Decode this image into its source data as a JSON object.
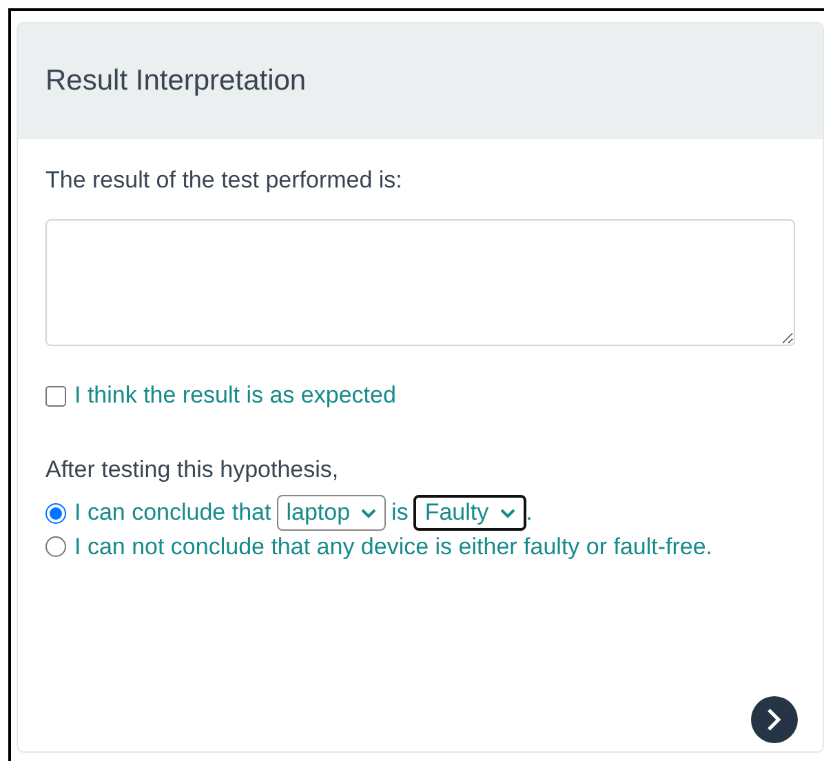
{
  "panel": {
    "title": "Result Interpretation",
    "prompt": "The result of the test performed is:",
    "expected_check": {
      "label": "I think the result is as expected",
      "checked": false
    },
    "conclusion": {
      "lead": "After testing this hypothesis,",
      "options": [
        {
          "kind": "statement",
          "selected": true,
          "text_before": "I can conclude that",
          "device": {
            "value": "laptop",
            "focused": false
          },
          "connector": "is",
          "status": {
            "value": "Faulty",
            "focused": true
          },
          "end": "."
        },
        {
          "kind": "text",
          "selected": false,
          "label": "I can not conclude that any device is either faulty or fault-free."
        }
      ]
    }
  }
}
